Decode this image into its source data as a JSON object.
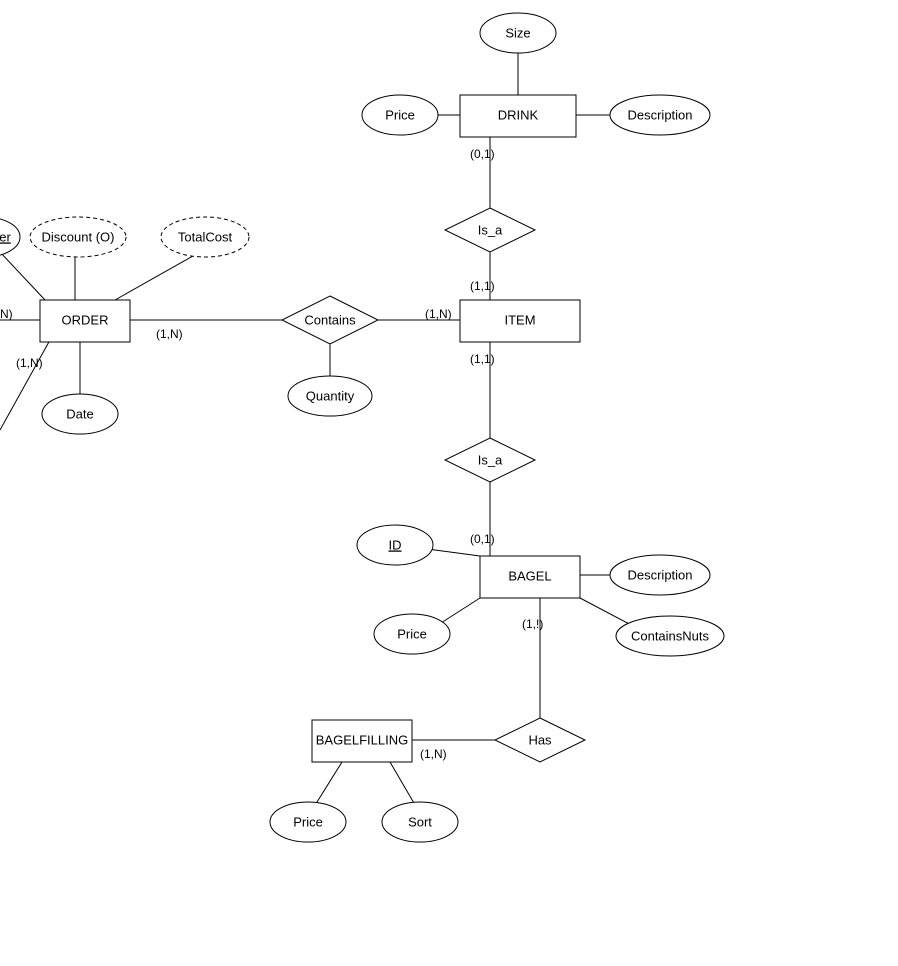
{
  "entities": {
    "order": "ORDER",
    "item": "ITEM",
    "drink": "DRINK",
    "bagel": "BAGEL",
    "bagelfilling": "BAGELFILLING"
  },
  "attributes": {
    "drink_size": "Size",
    "drink_price": "Price",
    "drink_desc": "Description",
    "order_partial": "er",
    "order_discount": "Discount (O)",
    "order_totalcost": "TotalCost",
    "order_date": "Date",
    "contains_qty": "Quantity",
    "bagel_id": "ID",
    "bagel_price": "Price",
    "bagel_desc": "Description",
    "bagel_nuts": "ContainsNuts",
    "bf_price": "Price",
    "bf_sort": "Sort"
  },
  "relationships": {
    "contains": "Contains",
    "isa_top": "Is_a",
    "isa_bot": "Is_a",
    "has": "Has"
  },
  "cardinalities": {
    "drink_isa": "(0,1)",
    "item_isa_top": "(1,1)",
    "item_isa_bot": "(1,1)",
    "bagel_isa": "(0,1)",
    "order_contains": "(1,N)",
    "item_contains": "(1,N)",
    "order_left": "N)",
    "order_down": "(1,N)",
    "bagel_has": "(1,!)",
    "bf_has": "(1,N)"
  }
}
